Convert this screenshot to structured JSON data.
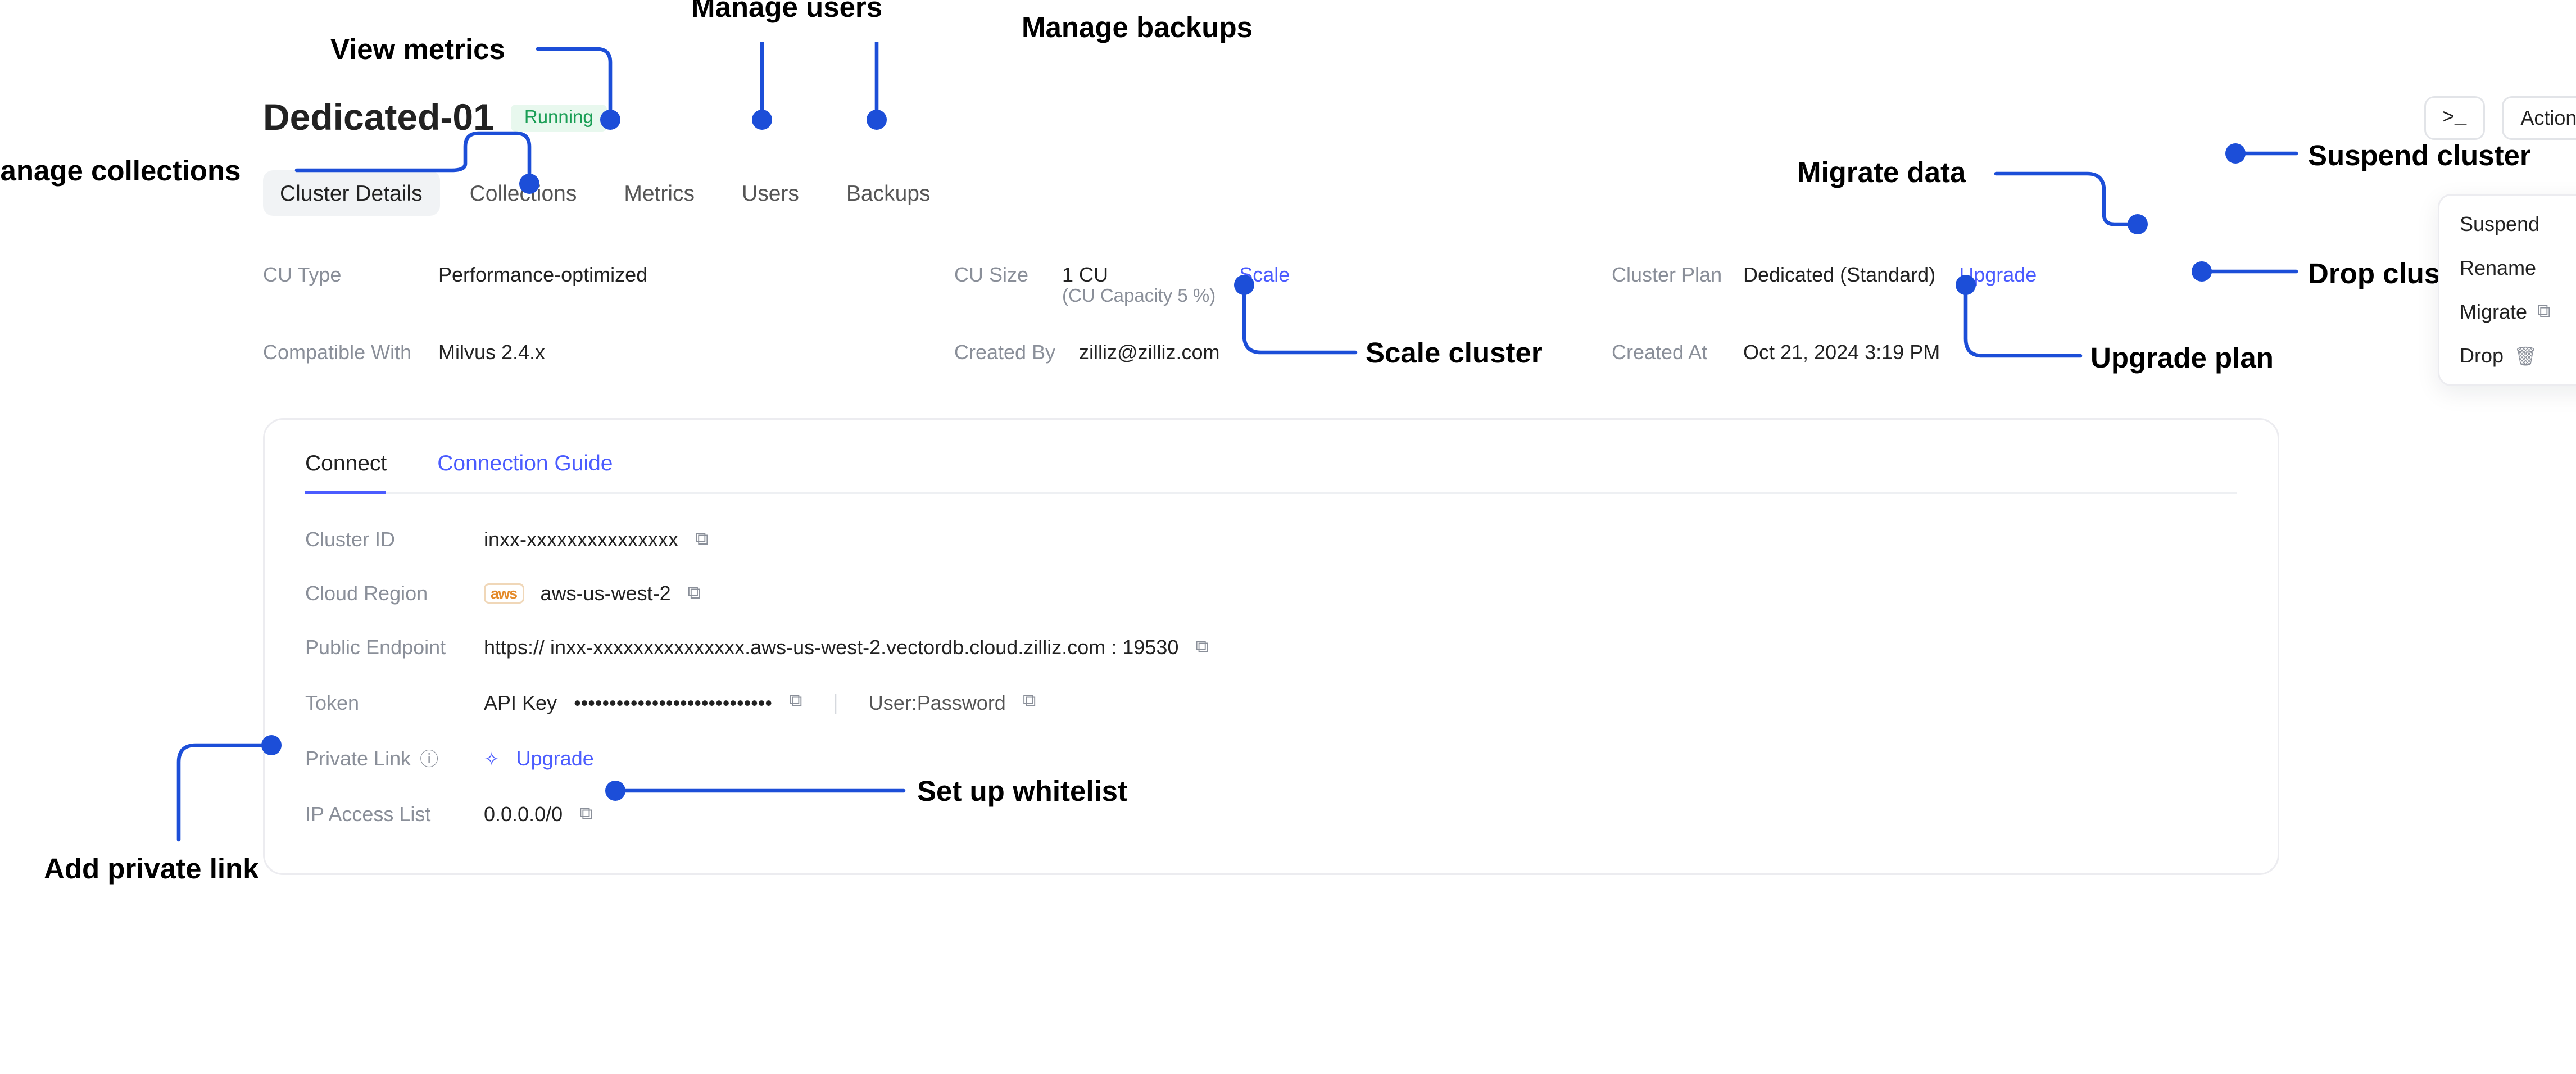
{
  "header": {
    "cluster_name": "Dedicated-01",
    "status": "Running",
    "cli_button": ">_",
    "actions_button": "Actions"
  },
  "tabs": {
    "details": "Cluster Details",
    "collections": "Collections",
    "metrics": "Metrics",
    "users": "Users",
    "backups": "Backups"
  },
  "info": {
    "cu_type_label": "CU Type",
    "cu_type_value": "Performance-optimized",
    "cu_size_label": "CU Size",
    "cu_size_value": "1 CU",
    "cu_size_sub": "(CU Capacity 5 %)",
    "scale_link": "Scale",
    "plan_label": "Cluster Plan",
    "plan_value": "Dedicated (Standard)",
    "upgrade_link": "Upgrade",
    "compat_label": "Compatible With",
    "compat_value": "Milvus 2.4.x",
    "created_by_label": "Created By",
    "created_by_value": "zilliz@zilliz.com",
    "created_at_label": "Created At",
    "created_at_value": "Oct 21, 2024 3:19 PM"
  },
  "conn": {
    "tab_connect": "Connect",
    "tab_guide": "Connection Guide",
    "cluster_id_label": "Cluster ID",
    "cluster_id_value": "inxx-xxxxxxxxxxxxxxx",
    "cloud_region_label": "Cloud Region",
    "cloud_provider": "aws",
    "cloud_region_value": "aws-us-west-2",
    "endpoint_label": "Public Endpoint",
    "endpoint_value": "https:// inxx-xxxxxxxxxxxxxxx.aws-us-west-2.vectordb.cloud.zilliz.com  :  19530",
    "token_label": "Token",
    "token_kind": "API Key",
    "token_masked": "••••••••••••••••••••••••••••",
    "token_userpass": "User:Password",
    "private_link_label": "Private Link",
    "private_link_upgrade": "Upgrade",
    "ip_list_label": "IP Access List",
    "ip_list_value": "0.0.0.0/0"
  },
  "actions_menu": {
    "suspend": "Suspend",
    "rename": "Rename",
    "migrate": "Migrate",
    "drop": "Drop"
  },
  "callouts": {
    "manage_users": "Manage users",
    "view_metrics": "View metrics",
    "manage_backups": "Manage backups",
    "manage_collections": "Manage collections",
    "migrate_data": "Migrate data",
    "suspend_cluster": "Suspend cluster",
    "drop_cluster": "Drop cluster",
    "scale_cluster": "Scale cluster",
    "upgrade_plan": "Upgrade plan",
    "set_up_whitelist": "Set up whitelist",
    "add_private_link": "Add private link"
  }
}
